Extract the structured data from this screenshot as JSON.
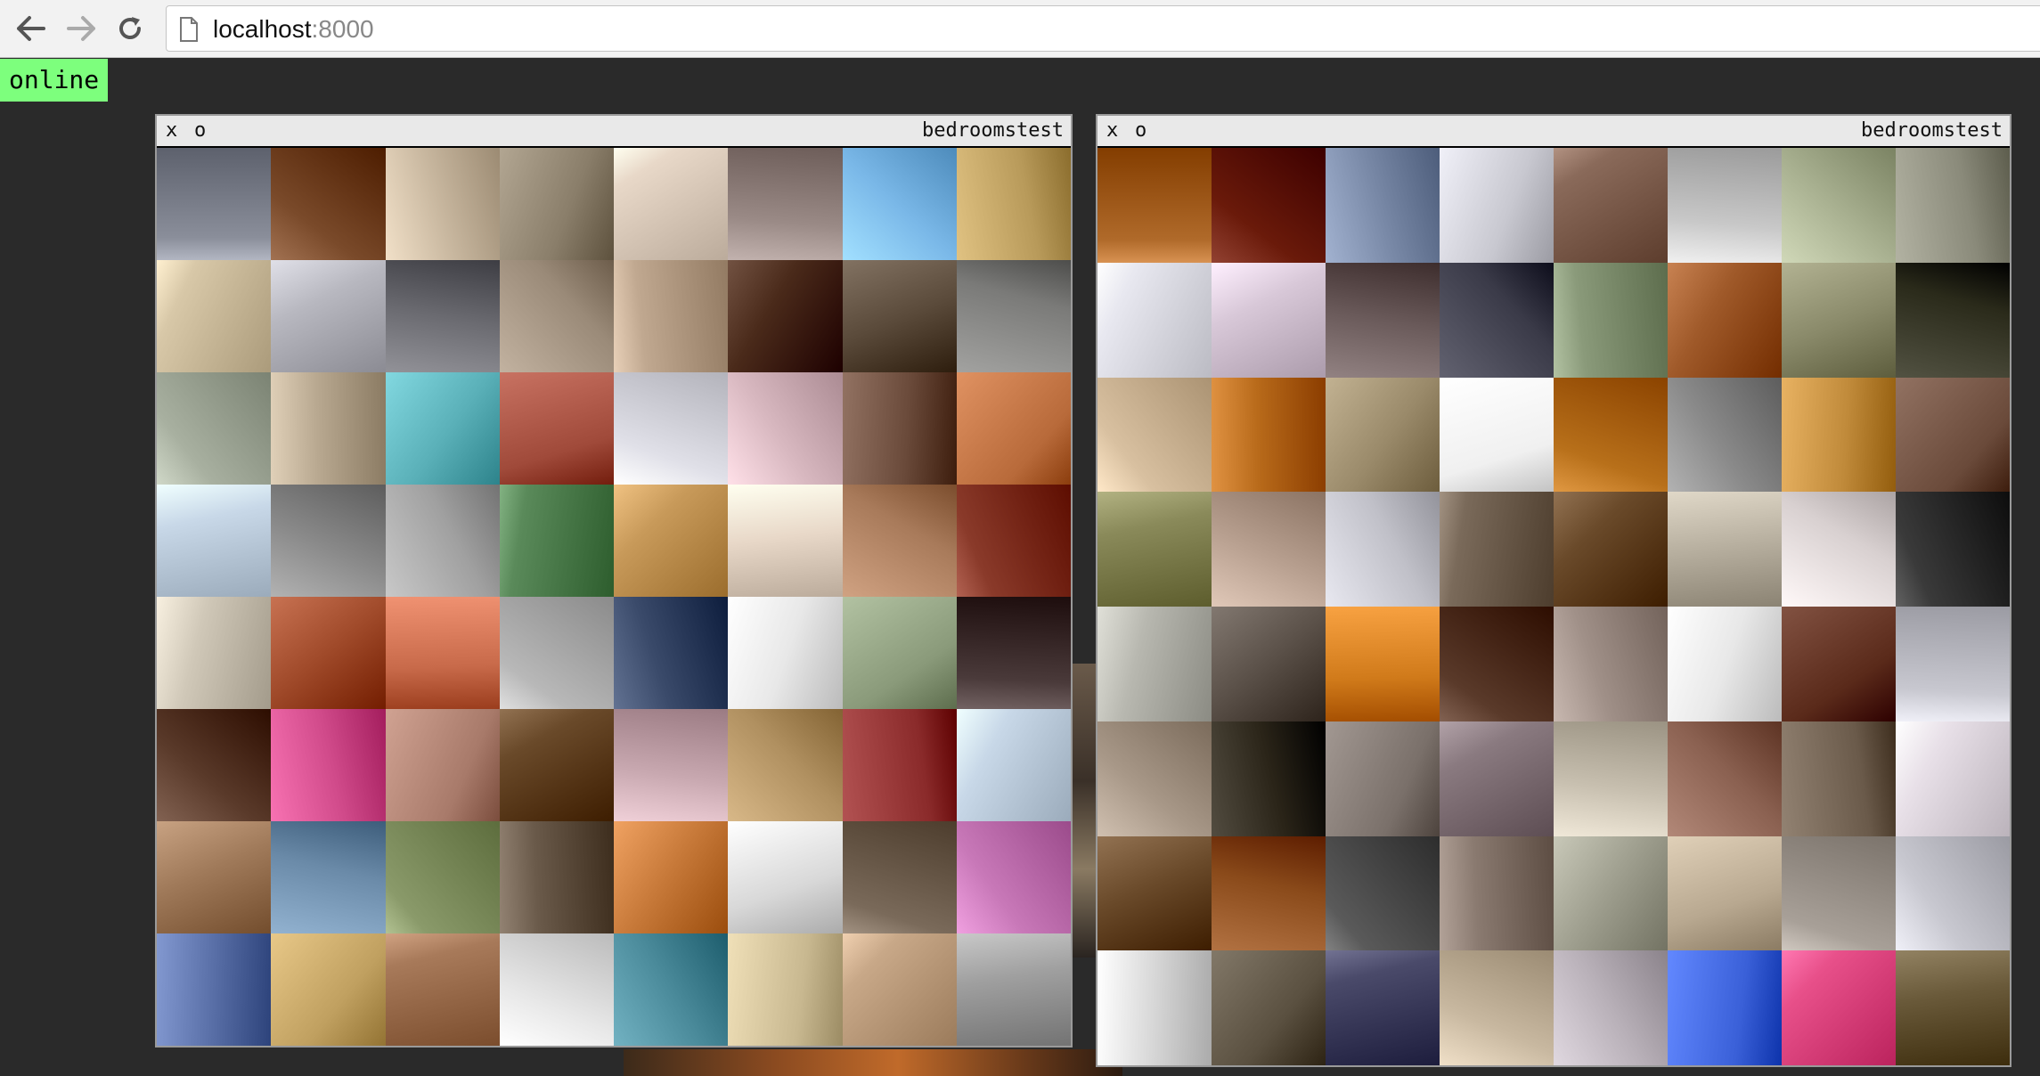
{
  "browser": {
    "url_host": "localhost",
    "url_port": ":8000",
    "back_icon": "arrow-left-icon",
    "forward_icon": "arrow-right-icon",
    "reload_icon": "reload-icon",
    "page_icon": "document-icon"
  },
  "status": {
    "label": "online",
    "color": "#7dff7d"
  },
  "panels": [
    {
      "close_label": "x",
      "minimize_label": "o",
      "title": "bedroomstest",
      "columns": 8,
      "rows": 8,
      "images": [
        "#8a8e9a",
        "#7a4a2a",
        "#c9b8a0",
        "#8a7e6a",
        "#e8d8c8",
        "#9a8a86",
        "#7ab8e8",
        "#b89a5a",
        "#d8c8a8",
        "#b8b8c0",
        "#6a6a70",
        "#9a8a78",
        "#c0a890",
        "#4a2a1a",
        "#5a4a3a",
        "#7a7a78",
        "#a8b0a0",
        "#b8a890",
        "#5ab0b8",
        "#a04a3a",
        "#e0e0e8",
        "#d8b8c0",
        "#6a4a3a",
        "#b86a3a",
        "#c8d8e8",
        "#8a8a8a",
        "#a0a0a0",
        "#5a8a5a",
        "#c89a5a",
        "#e8d8c8",
        "#a87a5a",
        "#8a3a2a",
        "#d0c8b8",
        "#a04a2a",
        "#c86a4a",
        "#b8b8b8",
        "#3a4a6a",
        "#e8e8e8",
        "#8a9a7a",
        "#4a3a3a",
        "#5a3a2a",
        "#d04a8a",
        "#a87a6a",
        "#6a4a2a",
        "#c8a8b0",
        "#b09060",
        "#8a2a2a",
        "#c8d8e8",
        "#a07a5a",
        "#6a8aa8",
        "#8a9a6a",
        "#6a5a4a",
        "#c87a3a",
        "#d8d8d8",
        "#7a6a5a",
        "#c878b8",
        "#5a70a8",
        "#c0a060",
        "#a87a5a",
        "#e8e8e8",
        "#4a8a9a",
        "#c8b890",
        "#c8a888",
        "#a0a0a0"
      ]
    },
    {
      "close_label": "x",
      "minimize_label": "o",
      "title": "bedroomstest",
      "columns": 8,
      "rows": 8,
      "images": [
        "#b06a2a",
        "#6a1a0a",
        "#7a8aa8",
        "#c8c8d0",
        "#8a6a5a",
        "#c8c8c8",
        "#a8b090",
        "#8a8a7a",
        "#e8e8f0",
        "#d8c8d8",
        "#6a5a5a",
        "#3a3a48",
        "#8a9a7a",
        "#a05a2a",
        "#8a8a6a",
        "#2a2a1a",
        "#d8c0a0",
        "#b86a1a",
        "#9a8a6a",
        "#f0f0f0",
        "#b8701a",
        "#8a8a8a",
        "#c08a3a",
        "#6a4a3a",
        "#8a8a5a",
        "#b8a090",
        "#c0c0c8",
        "#7a6a5a",
        "#6a4a2a",
        "#b8b0a0",
        "#d8d0d0",
        "#3a3a3a",
        "#b8b8b0",
        "#5a5048",
        "#d07a1a",
        "#5a3a2a",
        "#a09088",
        "#e8e8e8",
        "#5a2a1a",
        "#c8c8d0",
        "#a89888",
        "#2a2418",
        "#7a706a",
        "#8a7a80",
        "#c8c0b0",
        "#8a6050",
        "#6a5a4a",
        "#e8e0e8",
        "#6a4a2a",
        "#8a4a1a",
        "#5a5a5a",
        "#8a7a70",
        "#a0a090",
        "#b8a890",
        "#a8a098",
        "#c8c8d0",
        "#d8d8d8",
        "#5a5040",
        "#4a4a6a",
        "#c8b8a0",
        "#b8b0b8",
        "#3a60d8",
        "#e8508a",
        "#6a5a3a"
      ]
    }
  ]
}
